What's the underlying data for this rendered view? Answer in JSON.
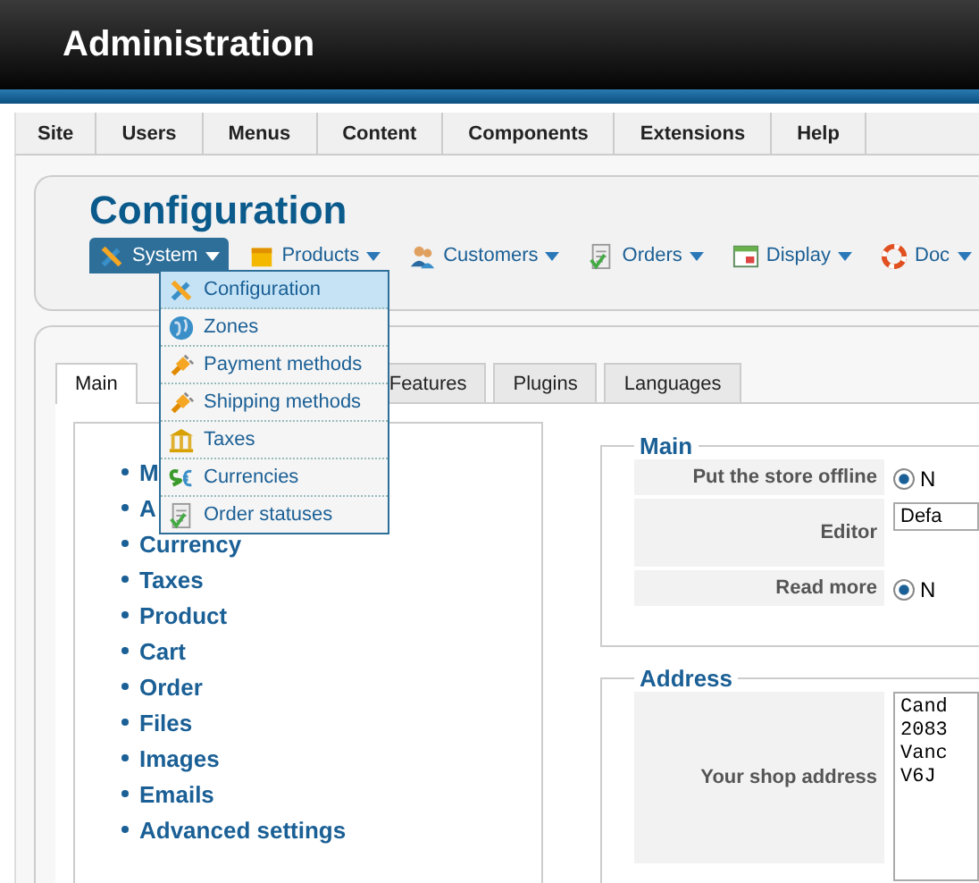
{
  "header": {
    "title": "Administration"
  },
  "nav": [
    {
      "label": "Site"
    },
    {
      "label": "Users"
    },
    {
      "label": "Menus"
    },
    {
      "label": "Content"
    },
    {
      "label": "Components"
    },
    {
      "label": "Extensions"
    },
    {
      "label": "Help"
    }
  ],
  "toolbar": {
    "title": "Configuration",
    "menus": [
      {
        "label": "System",
        "selected": true
      },
      {
        "label": "Products",
        "selected": false
      },
      {
        "label": "Customers",
        "selected": false
      },
      {
        "label": "Orders",
        "selected": false
      },
      {
        "label": "Display",
        "selected": false
      },
      {
        "label": "Doc",
        "selected": false
      }
    ]
  },
  "dropdown": [
    {
      "label": "Configuration",
      "selected": true
    },
    {
      "label": "Zones",
      "selected": false
    },
    {
      "label": "Payment methods",
      "selected": false
    },
    {
      "label": "Shipping methods",
      "selected": false
    },
    {
      "label": "Taxes",
      "selected": false
    },
    {
      "label": "Currencies",
      "selected": false
    },
    {
      "label": "Order statuses",
      "selected": false
    }
  ],
  "tabs": [
    {
      "label": "Main",
      "selected": true
    },
    {
      "label": "Features",
      "selected": false
    },
    {
      "label": "Plugins",
      "selected": false
    },
    {
      "label": "Languages",
      "selected": false
    }
  ],
  "sections": [
    {
      "label": "M"
    },
    {
      "label": "A"
    },
    {
      "label": "Currency"
    },
    {
      "label": "Taxes"
    },
    {
      "label": "Product"
    },
    {
      "label": "Cart"
    },
    {
      "label": "Order"
    },
    {
      "label": "Files"
    },
    {
      "label": "Images"
    },
    {
      "label": "Emails"
    },
    {
      "label": "Advanced settings"
    }
  ],
  "fieldsets": [
    {
      "legend": "Main",
      "rows": [
        {
          "label": "Put the store offline",
          "kind": "radio",
          "value": "N",
          "checked": true
        },
        {
          "label": "Editor",
          "kind": "select",
          "value": "Defa"
        },
        {
          "label": "Read more",
          "kind": "radio",
          "value": "N",
          "checked": true
        }
      ]
    },
    {
      "legend": "Address",
      "rows": [
        {
          "label": "Your shop address",
          "kind": "textarea",
          "lines": [
            "Cand",
            "2083",
            "Vanc",
            "V6J"
          ]
        }
      ]
    }
  ]
}
